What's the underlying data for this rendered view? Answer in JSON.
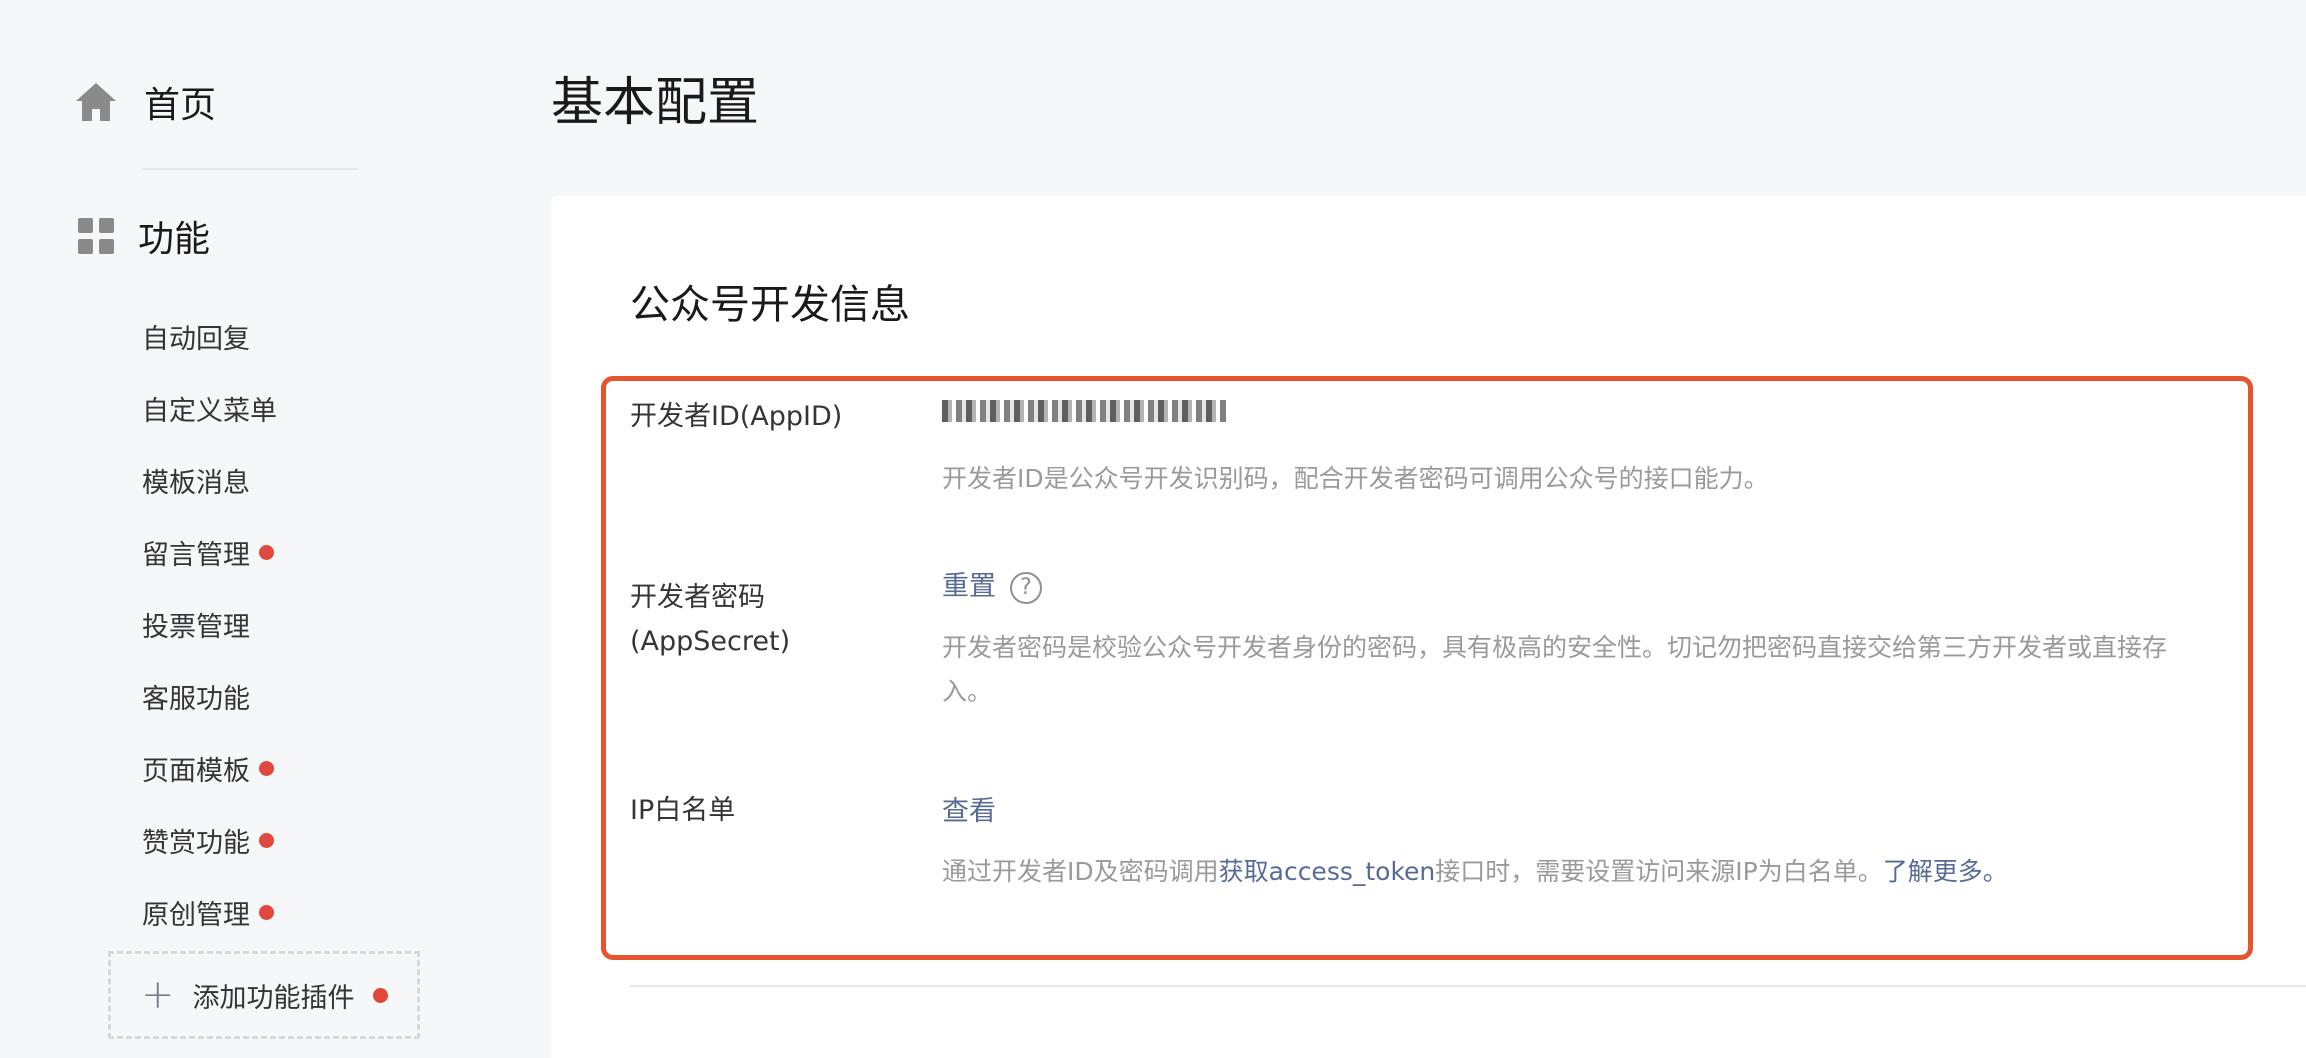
{
  "sidebar": {
    "home_label": "首页",
    "function_label": "功能",
    "items": [
      {
        "label": "自动回复",
        "dot": false
      },
      {
        "label": "自定义菜单",
        "dot": false
      },
      {
        "label": "模板消息",
        "dot": false
      },
      {
        "label": "留言管理",
        "dot": true
      },
      {
        "label": "投票管理",
        "dot": false
      },
      {
        "label": "客服功能",
        "dot": false
      },
      {
        "label": "页面模板",
        "dot": true
      },
      {
        "label": "赞赏功能",
        "dot": true
      },
      {
        "label": "原创管理",
        "dot": true
      }
    ],
    "add_plugin_label": "添加功能插件",
    "icons": {
      "home": "home-icon",
      "function": "grid-icon",
      "add": "plus-icon"
    }
  },
  "main": {
    "page_title": "基本配置",
    "card_title": "公众号开发信息",
    "appid": {
      "label": "开发者ID(AppID)",
      "desc": "开发者ID是公众号开发识别码，配合开发者密码可调用公众号的接口能力。"
    },
    "appsecret": {
      "label_line1": "开发者密码",
      "label_line2": "(AppSecret)",
      "reset_label": "重置",
      "help_glyph": "?",
      "desc_line1": "开发者密码是校验公众号开发者身份的密码，具有极高的安全性。切记勿把密码直接交给第三方开发者或直接存",
      "desc_line2": "入。"
    },
    "ip_whitelist": {
      "label": "IP白名单",
      "view_label": "查看",
      "desc_prefix": "通过开发者ID及密码调用",
      "desc_link": "获取access_token",
      "desc_middle": "接口时，需要设置访问来源IP为白名单。",
      "desc_more": "了解更多。"
    }
  },
  "colors": {
    "link": "#576b95",
    "highlight_border": "#e5542c",
    "badge": "#e0483d"
  }
}
